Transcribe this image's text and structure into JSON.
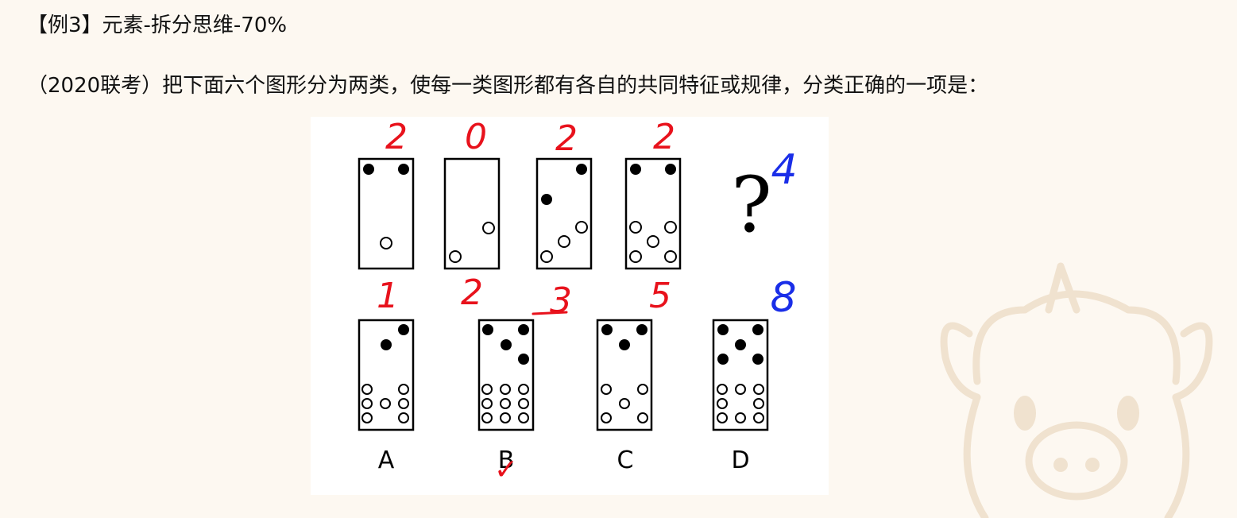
{
  "header": {
    "title": "【例3】元素-拆分思维-70%"
  },
  "question": {
    "text": "（2020联考）把下面六个图形分为两类，使每一类图形都有各自的共同特征或规律，分类正确的一项是："
  },
  "figure": {
    "question_mark": "?",
    "options": [
      {
        "label": "A",
        "black": 2,
        "white": 7
      },
      {
        "label": "B",
        "black": 4,
        "white": 9
      },
      {
        "label": "C",
        "black": 3,
        "white": 5
      },
      {
        "label": "D",
        "black": 5,
        "white": 8
      }
    ],
    "sequence": [
      {
        "black": 2,
        "white": 1
      },
      {
        "black": 0,
        "white": 2
      },
      {
        "black": 2,
        "white": 3
      },
      {
        "black": 2,
        "white": 5
      }
    ]
  },
  "annotations": {
    "top_counts": [
      "2",
      "0",
      "2",
      "2"
    ],
    "question_count": "4",
    "bottom_counts": [
      "1",
      "2",
      "3",
      "5"
    ],
    "question_bottom_count": "8",
    "answer_mark": "✓",
    "red_color": "#e8121c",
    "blue_color": "#1a2ee8"
  }
}
